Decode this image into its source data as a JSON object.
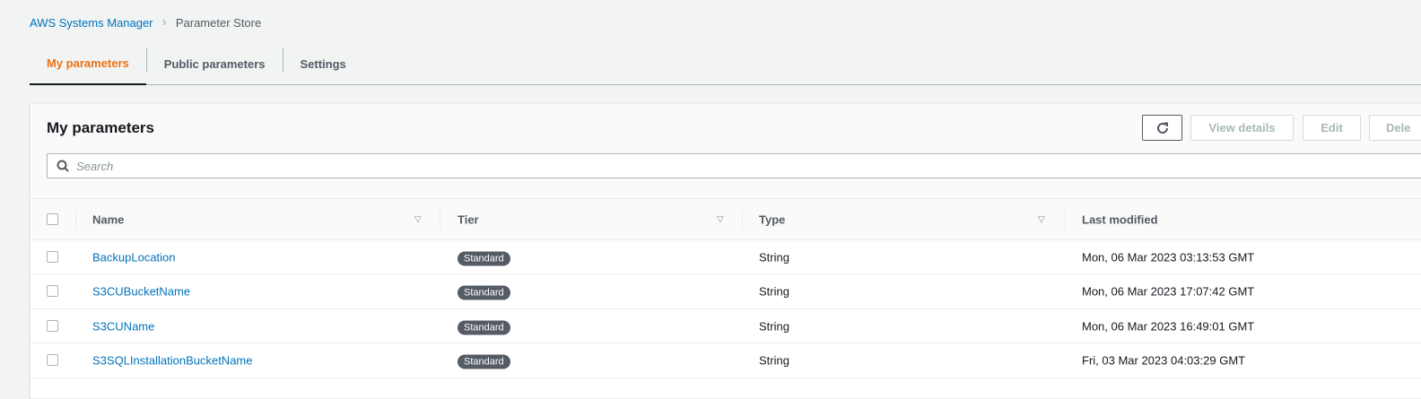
{
  "breadcrumb": {
    "parent": "AWS Systems Manager",
    "current": "Parameter Store"
  },
  "tabs": [
    "My parameters",
    "Public parameters",
    "Settings"
  ],
  "card": {
    "title": "My parameters",
    "buttons": {
      "view_details": "View details",
      "edit": "Edit",
      "delete": "Dele"
    },
    "search_placeholder": "Search"
  },
  "table": {
    "columns": [
      "Name",
      "Tier",
      "Type",
      "Last modified"
    ],
    "rows": [
      {
        "name": "BackupLocation",
        "tier": "Standard",
        "type": "String",
        "modified": "Mon, 06 Mar 2023 03:13:53 GMT"
      },
      {
        "name": "S3CUBucketName",
        "tier": "Standard",
        "type": "String",
        "modified": "Mon, 06 Mar 2023 17:07:42 GMT"
      },
      {
        "name": "S3CUName",
        "tier": "Standard",
        "type": "String",
        "modified": "Mon, 06 Mar 2023 16:49:01 GMT"
      },
      {
        "name": "S3SQLInstallationBucketName",
        "tier": "Standard",
        "type": "String",
        "modified": "Fri, 03 Mar 2023 04:03:29 GMT"
      }
    ]
  }
}
